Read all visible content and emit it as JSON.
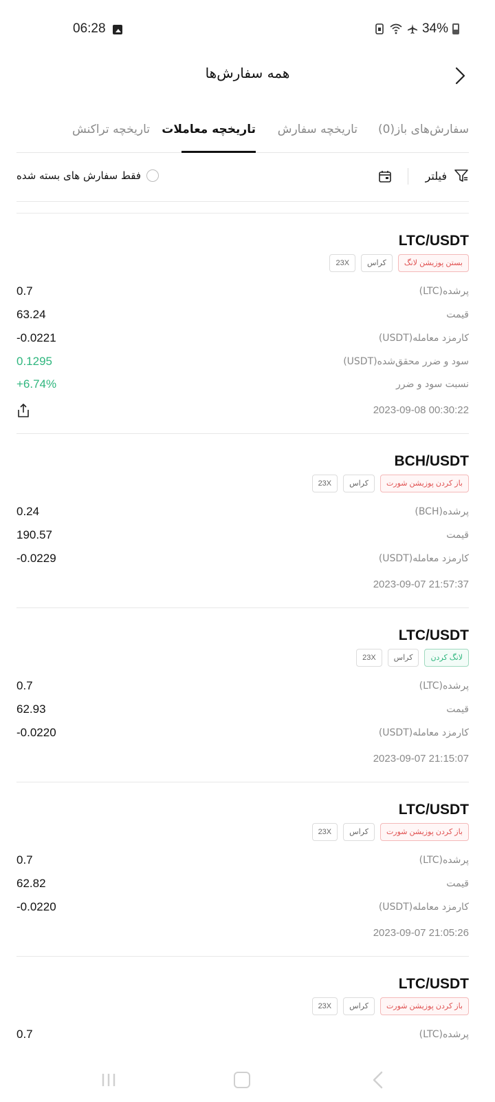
{
  "status": {
    "time": "06:28",
    "battery": "34%"
  },
  "header": {
    "title": "همه سفارش‌ها"
  },
  "tabs": [
    {
      "label": "سفارش‌های باز(0)"
    },
    {
      "label": "تاریخچه سفارش"
    },
    {
      "label": "تاریخچه معاملات",
      "active": true
    },
    {
      "label": "تاریخچه تراکنش"
    }
  ],
  "filter": {
    "label": "فیلتر",
    "closed_only": "فقط سفارش های بسته شده"
  },
  "trades": [
    {
      "pair": "LTC/USDT",
      "badges": [
        "بستن پوزیشن لانگ",
        "کراس",
        "23X"
      ],
      "rows": [
        {
          "label": "پرشده(LTC)",
          "value": "0.7"
        },
        {
          "label": "قیمت",
          "value": "63.24"
        },
        {
          "label": "کارمزد معامله(USDT)",
          "value": "-0.0221"
        },
        {
          "label": "سود و ضرر محقق‌شده(USDT)",
          "value": "0.1295"
        },
        {
          "label": "نسبت سود و ضرر",
          "value": "+6.74%"
        }
      ],
      "date": "2023-09-08 00:30:22"
    },
    {
      "pair": "BCH/USDT",
      "badges": [
        "باز کردن پوزیشن شورت",
        "کراس",
        "23X"
      ],
      "rows": [
        {
          "label": "پرشده(BCH)",
          "value": "0.24"
        },
        {
          "label": "قیمت",
          "value": "190.57"
        },
        {
          "label": "کارمزد معامله(USDT)",
          "value": "-0.0229"
        }
      ],
      "date": "2023-09-07 21:57:37"
    },
    {
      "pair": "LTC/USDT",
      "badges": [
        "لانگ کردن",
        "کراس",
        "23X"
      ],
      "rows": [
        {
          "label": "پرشده(LTC)",
          "value": "0.7"
        },
        {
          "label": "قیمت",
          "value": "62.93"
        },
        {
          "label": "کارمزد معامله(USDT)",
          "value": "-0.0220"
        }
      ],
      "date": "2023-09-07 21:15:07"
    },
    {
      "pair": "LTC/USDT",
      "badges": [
        "باز کردن پوزیشن شورت",
        "کراس",
        "23X"
      ],
      "rows": [
        {
          "label": "پرشده(LTC)",
          "value": "0.7"
        },
        {
          "label": "قیمت",
          "value": "62.82"
        },
        {
          "label": "کارمزد معامله(USDT)",
          "value": "-0.0220"
        }
      ],
      "date": "2023-09-07 21:05:26"
    },
    {
      "pair": "LTC/USDT",
      "badges": [
        "باز کردن پوزیشن شورت",
        "کراس",
        "23X"
      ],
      "rows": [
        {
          "label": "پرشده(LTC)",
          "value": "0.7"
        }
      ]
    }
  ],
  "colors": {
    "profit_green": "#2fb67e",
    "loss_red": "#e05252"
  },
  "icons": [
    "gallery-icon",
    "wifi-icon",
    "airplane-icon",
    "back-arrow-icon",
    "filter-icon",
    "calendar-icon",
    "share-icon"
  ]
}
